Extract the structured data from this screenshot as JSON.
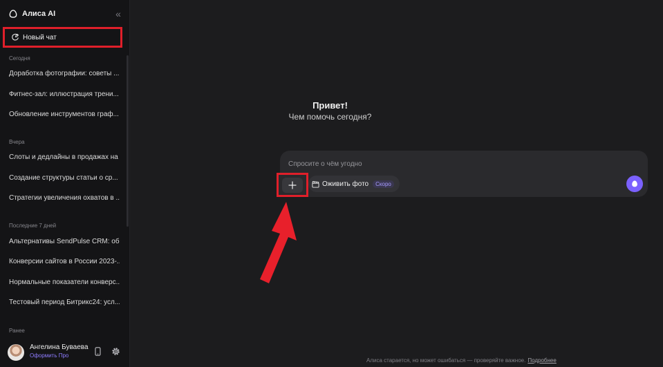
{
  "brand": {
    "name": "Алиса AI",
    "logo_icon": "alice-logo-icon"
  },
  "sidebar": {
    "collapse_icon": "chevrons-left-icon",
    "new_chat_label": "Новый чат",
    "sections": [
      {
        "title": "Сегодня",
        "items": [
          "Доработка фотографии: советы ...",
          "Фитнес-зал: иллюстрация трени...",
          "Обновление инструментов граф..."
        ]
      },
      {
        "title": "Вчера",
        "items": [
          "Слоты и дедлайны в продажах на ...",
          "Создание структуры статьи о ср...",
          "Стратегии увеличения охватов в ..."
        ]
      },
      {
        "title": "Последние 7 дней",
        "items": [
          "Альтернативы SendPulse CRM: об...",
          "Конверсии сайтов в России 2023-...",
          "Нормальные показатели конверс...",
          "Тестовый период Битрикс24: усл..."
        ]
      },
      {
        "title": "Ранее",
        "items": []
      }
    ]
  },
  "user": {
    "name": "Ангелина Буваева",
    "plan_link": "Оформить Про"
  },
  "main": {
    "greeting_title": "Привет!",
    "greeting_subtitle": "Чем помочь сегодня?",
    "input_placeholder": "Спросите о чём угодно",
    "chip_label": "Оживить фото",
    "chip_badge": "Скоро",
    "footer_text": "Алиса старается, но может ошибаться — проверяйте важное.",
    "footer_link": "Подробнее"
  },
  "colors": {
    "highlight": "#e01f2a",
    "accent": "#7b61ff",
    "background": "#1c1c1e",
    "sidebar": "#141416"
  }
}
